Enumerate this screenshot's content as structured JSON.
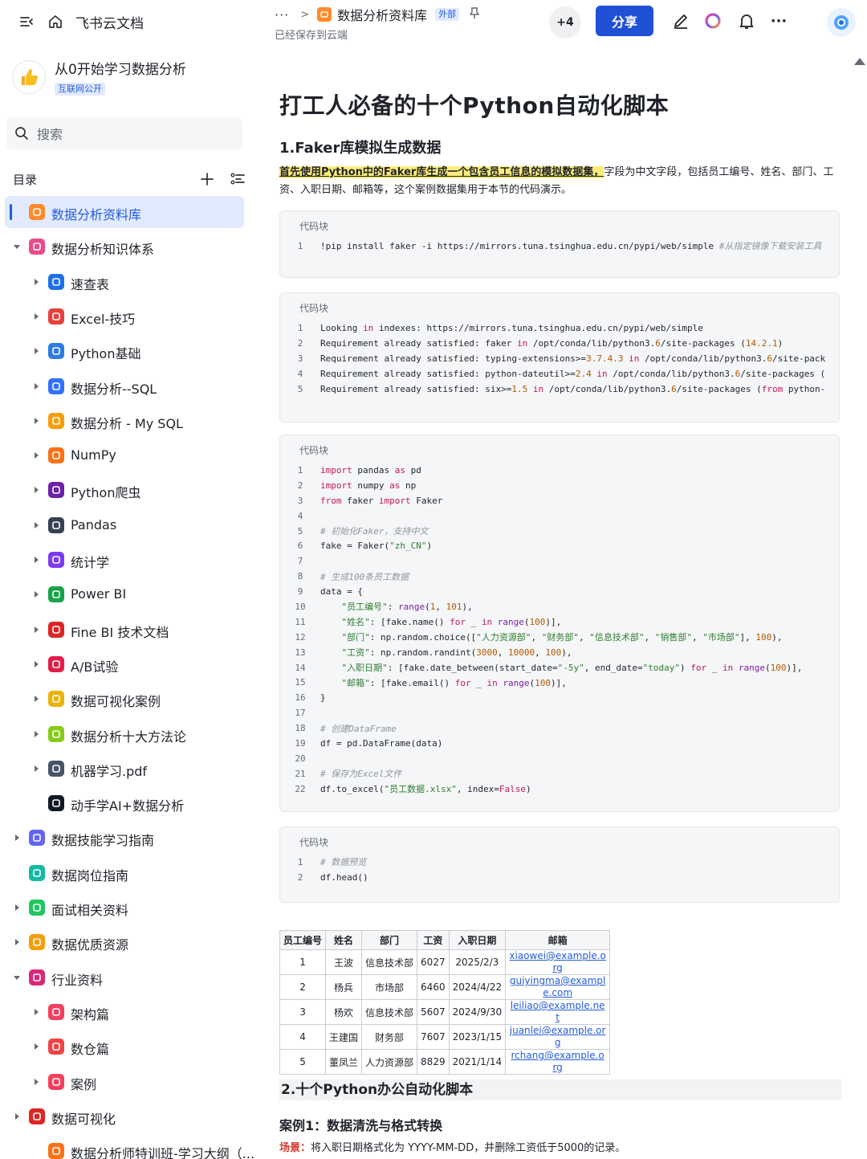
{
  "sidebar": {
    "brand": "飞书云文档",
    "wiki_title": "从0开始学习数据分析",
    "wiki_badge": "互联网公开",
    "search_placeholder": "搜索",
    "toc_label": "目录",
    "items": [
      {
        "label": "数据分析资料库",
        "icon": "folder-orange-icon",
        "color": "#ff8a2b",
        "level": 0,
        "arrow": "",
        "active": true
      },
      {
        "label": "数据分析知识体系",
        "icon": "book-pink-icon",
        "color": "#e84c8b",
        "level": 0,
        "arrow": "down"
      },
      {
        "label": "速查表",
        "icon": "magnifier-emoji-icon",
        "color": "#1f6feb",
        "level": 1,
        "arrow": "right"
      },
      {
        "label": "Excel-技巧",
        "icon": "hundred-emoji-icon",
        "color": "#e8413c",
        "level": 1,
        "arrow": "right"
      },
      {
        "label": "Python基础",
        "icon": "monitor-emoji-icon",
        "color": "#2c7be5",
        "level": 1,
        "arrow": "right"
      },
      {
        "label": "数据分析--SQL",
        "icon": "bar-chart-emoji-icon",
        "color": "#3370ff",
        "level": 1,
        "arrow": "right"
      },
      {
        "label": "数据分析 - My SQL",
        "icon": "rainbow-emoji-icon",
        "color": "#f59e0b",
        "level": 1,
        "arrow": "right"
      },
      {
        "label": "NumPy",
        "icon": "memo-emoji-icon",
        "color": "#f97316",
        "level": 1,
        "arrow": "right"
      },
      {
        "label": "Python爬虫",
        "icon": "spider-emoji-icon",
        "color": "#6b21a8",
        "level": 1,
        "arrow": "right"
      },
      {
        "label": "Pandas",
        "icon": "panda-emoji-icon",
        "color": "#374151",
        "level": 1,
        "arrow": "right"
      },
      {
        "label": "统计学",
        "icon": "floppy-emoji-icon",
        "color": "#7c3aed",
        "level": 1,
        "arrow": "right"
      },
      {
        "label": "Power BI",
        "icon": "recycle-emoji-icon",
        "color": "#16a34a",
        "level": 1,
        "arrow": "right"
      },
      {
        "label": "Fine BI 技术文档",
        "icon": "pushpin-emoji-icon",
        "color": "#dc2626",
        "level": 1,
        "arrow": "right"
      },
      {
        "label": "A/B试验",
        "icon": "ab-emoji-icon",
        "color": "#e11d48",
        "level": 1,
        "arrow": "right"
      },
      {
        "label": "数据可视化案例",
        "icon": "medal-emoji-icon",
        "color": "#eab308",
        "level": 1,
        "arrow": "right"
      },
      {
        "label": "数据分析十大方法论",
        "icon": "sparkle-emoji-icon",
        "color": "#84cc16",
        "level": 1,
        "arrow": "right"
      },
      {
        "label": "机器学习.pdf",
        "icon": "robot-emoji-icon",
        "color": "#475569",
        "level": 1,
        "arrow": "right"
      },
      {
        "label": "动手学AI+数据分析",
        "icon": "battery-emoji-icon",
        "color": "#111827",
        "level": 1,
        "arrow": ""
      },
      {
        "label": "数据技能学习指南",
        "icon": "shield-purple-icon",
        "color": "#6366f1",
        "level": 0,
        "arrow": "right"
      },
      {
        "label": "数据岗位指南",
        "icon": "compass-teal-icon",
        "color": "#14b8a6",
        "level": 0,
        "arrow": ""
      },
      {
        "label": "面试相关资料",
        "icon": "clock-green-icon",
        "color": "#22c55e",
        "level": 0,
        "arrow": "right"
      },
      {
        "label": "数据优质资源",
        "icon": "thumbs-up-emoji-icon",
        "color": "#f59e0b",
        "level": 0,
        "arrow": "right"
      },
      {
        "label": "行业资料",
        "icon": "ribbon-emoji-icon",
        "color": "#db2777",
        "level": 0,
        "arrow": "down"
      },
      {
        "label": "架构篇",
        "icon": "sheet-pink-icon",
        "color": "#f43f5e",
        "level": 1,
        "arrow": "right"
      },
      {
        "label": "数仓篇",
        "icon": "calendar-red-icon",
        "color": "#ef4444",
        "level": 1,
        "arrow": "right"
      },
      {
        "label": "案例",
        "icon": "target-red-icon",
        "color": "#f43f5e",
        "level": 1,
        "arrow": "right"
      },
      {
        "label": "数据可视化",
        "icon": "rocket-emoji-icon",
        "color": "#dc2626",
        "level": 0,
        "arrow": "right"
      },
      {
        "label": "数据分析师特训班-学习大纲（...",
        "icon": "pencil-emoji-icon",
        "color": "#f97316",
        "level": 1,
        "arrow": ""
      }
    ]
  },
  "header": {
    "crumb_dots": "···",
    "crumb_chevron": ">",
    "doc_title": "数据分析资料库",
    "ext_badge": "外部",
    "saved_text": "已经保存到云端",
    "collaborators": "+4",
    "share_label": "分享",
    "more": "···"
  },
  "doc": {
    "title": "打工人必备的十个Python自动化脚本",
    "h2": "1.Faker库模拟生成数据",
    "para_highlight": "首先使用Python中的Faker库生成一个包含员工信息的模拟数据集，",
    "para_rest": "字段为中文字段，包括员工编号、姓名、部门、工资、入职日期、邮箱等，这个案例数据集用于本节的代码演示。",
    "code_caption": "代码块",
    "code1": [
      "!pip install faker -i https://mirrors.tuna.tsinghua.edu.cn/pypi/web/simple #从指定镜像下载安装工具"
    ],
    "code2": [
      "Looking in indexes: https://mirrors.tuna.tsinghua.edu.cn/pypi/web/simple",
      "Requirement already satisfied: faker in /opt/conda/lib/python3.6/site-packages (14.2.1)",
      "Requirement already satisfied: typing-extensions>=3.7.4.3 in /opt/conda/lib/python3.6/site-pack",
      "Requirement already satisfied: python-dateutil>=2.4 in /opt/conda/lib/python3.6/site-packages (",
      "Requirement already satisfied: six>=1.5 in /opt/conda/lib/python3.6/site-packages (from python-"
    ],
    "code3": [
      "import pandas as pd",
      "import numpy as np",
      "from faker import Faker",
      "",
      "# 初始化Faker，支持中文",
      "fake = Faker(\"zh_CN\")",
      "",
      "# 生成100条员工数据",
      "data = {",
      "    \"员工编号\": range(1, 101),",
      "    \"姓名\": [fake.name() for _ in range(100)],",
      "    \"部门\": np.random.choice([\"人力资源部\", \"财务部\", \"信息技术部\", \"销售部\", \"市场部\"], 100),",
      "    \"工资\": np.random.randint(3000, 10000, 100),",
      "    \"入职日期\": [fake.date_between(start_date=\"-5y\", end_date=\"today\") for _ in range(100)],",
      "    \"邮箱\": [fake.email() for _ in range(100)],",
      "}",
      "",
      "# 创建DataFrame",
      "df = pd.DataFrame(data)",
      "",
      "# 保存为Excel文件",
      "df.to_excel(\"员工数据.xlsx\", index=False)"
    ],
    "code4": [
      "# 数据预览",
      "df.head()"
    ],
    "table": {
      "headers": [
        "员工编号",
        "姓名",
        "部门",
        "工资",
        "入职日期",
        "邮箱"
      ],
      "rows": [
        [
          "1",
          "王波",
          "信息技术部",
          "6027",
          "2025/2/3",
          "xiaowei@example.org"
        ],
        [
          "2",
          "杨兵",
          "市场部",
          "6460",
          "2024/4/22",
          "guiyingma@example.com"
        ],
        [
          "3",
          "杨欢",
          "信息技术部",
          "5607",
          "2024/9/30",
          "leiliao@example.net"
        ],
        [
          "4",
          "王建国",
          "财务部",
          "7607",
          "2023/1/15",
          "juanlei@example.org"
        ],
        [
          "5",
          "董凤兰",
          "人力资源部",
          "8829",
          "2021/1/14",
          "rchang@example.org"
        ]
      ]
    },
    "sec2": "2.十个Python办公自动化脚本",
    "case1": "案例1：数据清洗与格式转换",
    "scene_key": "场景：",
    "scene_text": "将入职日期格式化为 YYYY-MM-DD，并删除工资低于5000的记录。"
  }
}
